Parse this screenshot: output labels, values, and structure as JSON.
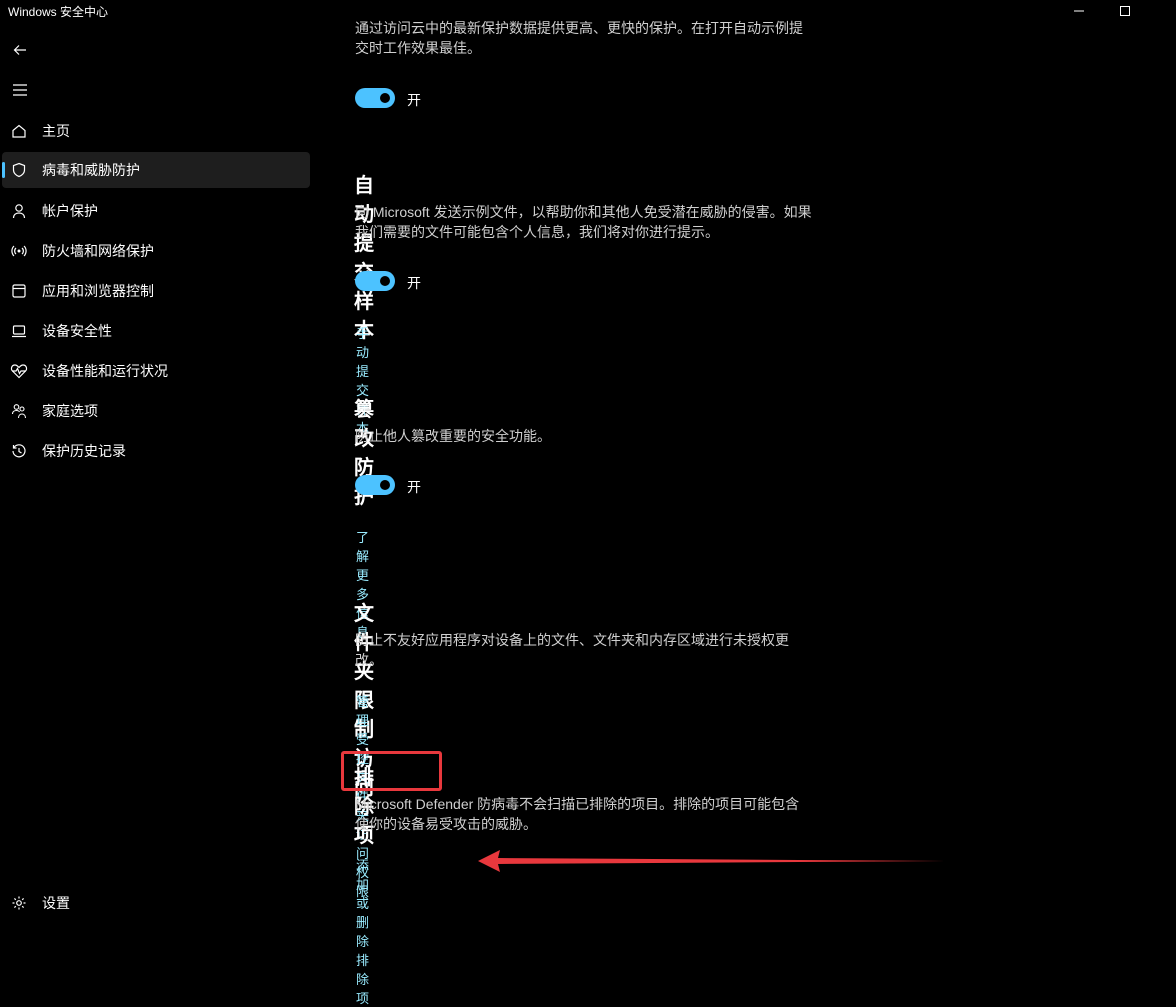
{
  "window": {
    "title": "Windows 安全中心"
  },
  "sidebar": {
    "items": [
      {
        "label": "主页"
      },
      {
        "label": "病毒和威胁防护"
      },
      {
        "label": "帐户保护"
      },
      {
        "label": "防火墙和网络保护"
      },
      {
        "label": "应用和浏览器控制"
      },
      {
        "label": "设备安全性"
      },
      {
        "label": "设备性能和运行状况"
      },
      {
        "label": "家庭选项"
      },
      {
        "label": "保护历史记录"
      }
    ],
    "settings_label": "设置"
  },
  "main": {
    "cloud": {
      "desc_partial": "通过访问云中的最新保护数据提供更高、更快的保护。在打开自动示例提交时工作效果最佳。",
      "desc_line1": "通过访问云中的最新保护数据提供更高、更快的保护。在打开自动示例提",
      "desc_line2": "交时工作效果最佳。",
      "toggle_label": "开"
    },
    "auto_submit": {
      "title": "自动提交样本",
      "desc_line1": "向 Microsoft 发送示例文件，以帮助你和其他人免受潜在威胁的侵害。如果",
      "desc_line2": "我们需要的文件可能包含个人信息，我们将对你进行提示。",
      "toggle_label": "开",
      "link": "手动提交样本"
    },
    "tamper": {
      "title": "篡改防护",
      "desc": "防止他人篡改重要的安全功能。",
      "toggle_label": "开",
      "link": "了解更多信息"
    },
    "folder_access": {
      "title": "文件夹限制访问",
      "desc_line1": "防止不友好应用程序对设备上的文件、文件夹和内存区域进行未授权更",
      "desc_line2": "改。",
      "link": "管理受控文件夹访问权限"
    },
    "exclusions": {
      "title": "排除项",
      "desc_line1": "Microsoft Defender 防病毒不会扫描已排除的项目。排除的项目可能包含",
      "desc_line2": "使你的设备易受攻击的威胁。",
      "link": "添加或删除排除项"
    }
  },
  "annotation": {
    "box_color": "#e8383d",
    "arrow_color": "#e8383d"
  },
  "colors": {
    "accent": "#4cc2ff",
    "link": "#99ebff",
    "background": "#000000"
  }
}
